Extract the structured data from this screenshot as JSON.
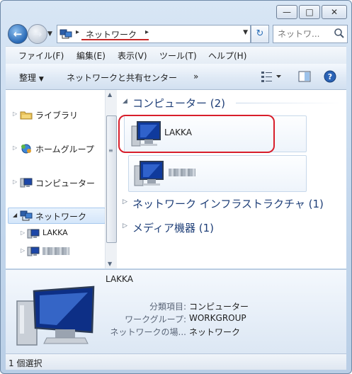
{
  "window": {
    "min_icon": "minimize-icon",
    "max_icon": "maximize-icon",
    "close_icon": "close-icon"
  },
  "address": {
    "crumb": "ネットワーク"
  },
  "search": {
    "placeholder": "ネットワ..."
  },
  "menu": {
    "items": [
      "ファイル(F)",
      "編集(E)",
      "表示(V)",
      "ツール(T)",
      "ヘルプ(H)"
    ]
  },
  "toolbar": {
    "organize": "整理",
    "network_center": "ネットワークと共有センター",
    "more": "»"
  },
  "nav": {
    "items": [
      {
        "label": "ライブラリ",
        "icon": "library-icon"
      },
      {
        "label": "ホームグループ",
        "icon": "homegroup-icon"
      },
      {
        "label": "コンピューター",
        "icon": "computer-icon"
      },
      {
        "label": "ネットワーク",
        "icon": "network-icon"
      },
      {
        "label": "LAKKA",
        "icon": "computer-icon"
      }
    ]
  },
  "groups": [
    {
      "title": "コンピューター (2)"
    },
    {
      "title": "ネットワーク インフラストラクチャ (1)"
    },
    {
      "title": "メディア機器 (1)"
    }
  ],
  "tiles": [
    {
      "name": "LAKKA"
    }
  ],
  "details": {
    "name": "LAKKA",
    "rows": [
      {
        "label": "分類項目:",
        "value": "コンピューター"
      },
      {
        "label": "ワークグループ:",
        "value": "WORKGROUP"
      },
      {
        "label": "ネットワークの場...",
        "value": "ネットワーク"
      }
    ]
  },
  "status": {
    "text": "1 個選択"
  },
  "colors": {
    "highlight": "#d81e2b",
    "group_title": "#1f3f78",
    "address_underline": "#c62828"
  }
}
